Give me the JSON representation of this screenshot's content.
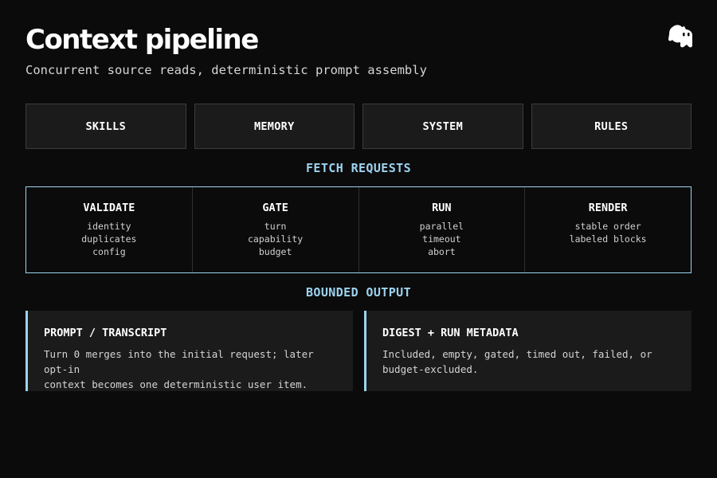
{
  "header": {
    "title": "Context pipeline",
    "subtitle": "Concurrent source reads, deterministic prompt assembly",
    "logo_icon": "claude-code-mascot-icon"
  },
  "sources": [
    {
      "label": "SKILLS"
    },
    {
      "label": "MEMORY"
    },
    {
      "label": "SYSTEM"
    },
    {
      "label": "RULES"
    }
  ],
  "fetch": {
    "label": "FETCH REQUESTS",
    "stages": [
      {
        "title": "VALIDATE",
        "items": [
          "identity",
          "duplicates",
          "config"
        ]
      },
      {
        "title": "GATE",
        "items": [
          "turn",
          "capability",
          "budget"
        ]
      },
      {
        "title": "RUN",
        "items": [
          "parallel",
          "timeout",
          "abort"
        ]
      },
      {
        "title": "RENDER",
        "items": [
          "stable order",
          "labeled blocks"
        ]
      }
    ]
  },
  "bounded": {
    "label": "BOUNDED OUTPUT",
    "cards": [
      {
        "title": "PROMPT / TRANSCRIPT",
        "lines": [
          "Turn 0 merges into the initial request; later opt-in",
          "context becomes one deterministic user item."
        ]
      },
      {
        "title": "DIGEST + RUN METADATA",
        "lines": [
          "Included, empty, gated, timed out, failed, or",
          "budget-excluded."
        ]
      }
    ]
  },
  "colors": {
    "background": "#0b0b0b",
    "panel": "#1b1b1b",
    "accent": "#9dd3ef",
    "text": "#ffffff"
  }
}
